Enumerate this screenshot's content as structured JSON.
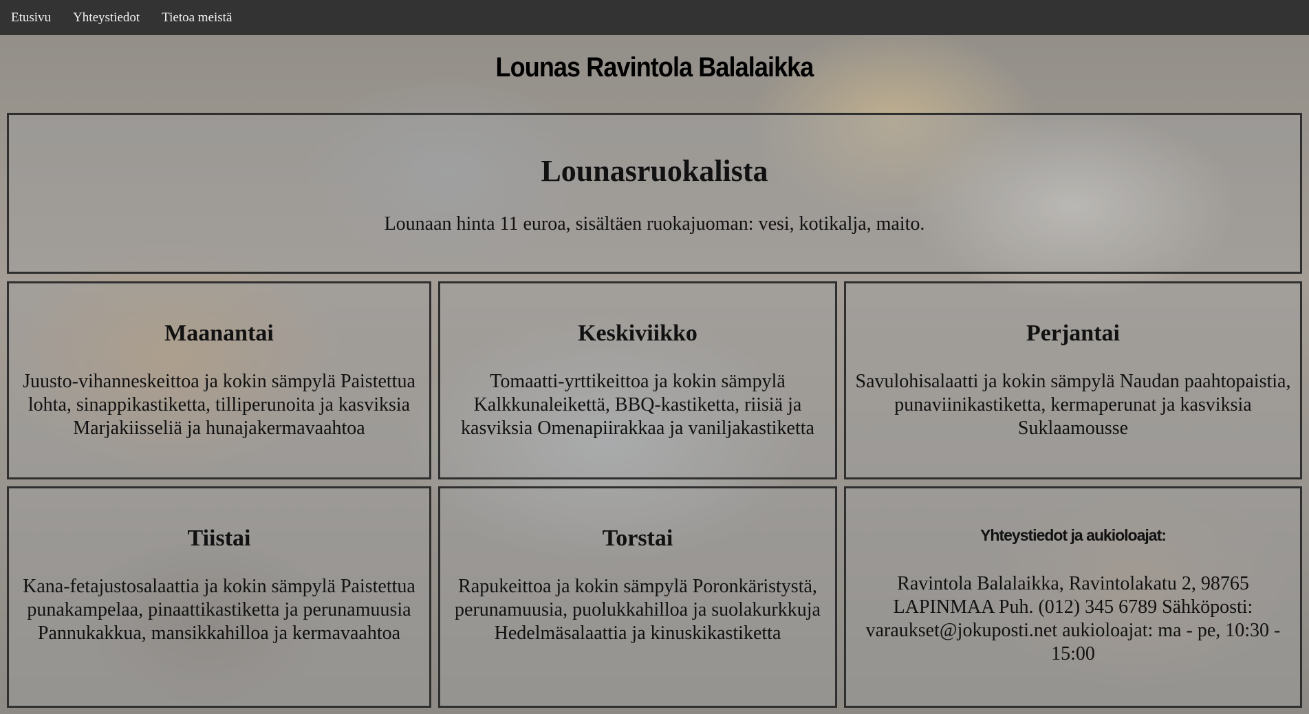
{
  "nav": {
    "items": [
      "Etusivu",
      "Yhteystiedot",
      "Tietoa meistä"
    ]
  },
  "site_title": "Lounas Ravintola Balalaikka",
  "menu": {
    "heading": "Lounasruokalista",
    "price_text": "Lounaan hinta 11 euroa, sisältäen ruokajuoman: vesi, kotikalja, maito."
  },
  "days": {
    "monday": {
      "name": "Maanantai",
      "text": "Juusto-vihanneskeittoa ja kokin sämpylä Paistettua lohta, sinappikastiketta, tilliperunoita ja kasviksia Marjakiisseliä ja hunajakermavaahtoa"
    },
    "tuesday": {
      "name": "Tiistai",
      "text": "Kana-fetajustosalaattia ja kokin sämpylä Paistettua punakampelaa, pinaattikastiketta ja perunamuusia Pannukakkua, mansikkahilloa ja kermavaahtoa"
    },
    "wednesday": {
      "name": "Keskiviikko",
      "text": "Tomaatti-yrttikeittoa ja kokin sämpylä Kalkkunaleikettä, BBQ-kastiketta, riisiä ja kasviksia Omenapiirakkaa ja vaniljakastiketta"
    },
    "thursday": {
      "name": "Torstai",
      "text": "Rapukeittoa ja kokin sämpylä Poronkäristystä, perunamuusia, puolukkahilloa ja suolakurkkuja Hedelmäsalaattia ja kinuskikastiketta"
    },
    "friday": {
      "name": "Perjantai",
      "text": "Savulohisalaatti ja kokin sämpylä Naudan paahtopaistia, punaviinikastiketta, kermaperunat ja kasviksia Suklaamousse"
    }
  },
  "contact": {
    "heading": "Yhteystiedot ja aukioloajat:",
    "text": "Ravintola Balalaikka, Ravintolakatu 2, 98765 LAPINMAA Puh. (012) 345 6789 Sähköposti: varaukset@jokuposti.net aukioloajat: ma - pe, 10:30 - 15:00"
  },
  "colors": {
    "nav_background": "#333333",
    "nav_text": "#f2f2f2",
    "panel_border": "#2f2f2f"
  }
}
